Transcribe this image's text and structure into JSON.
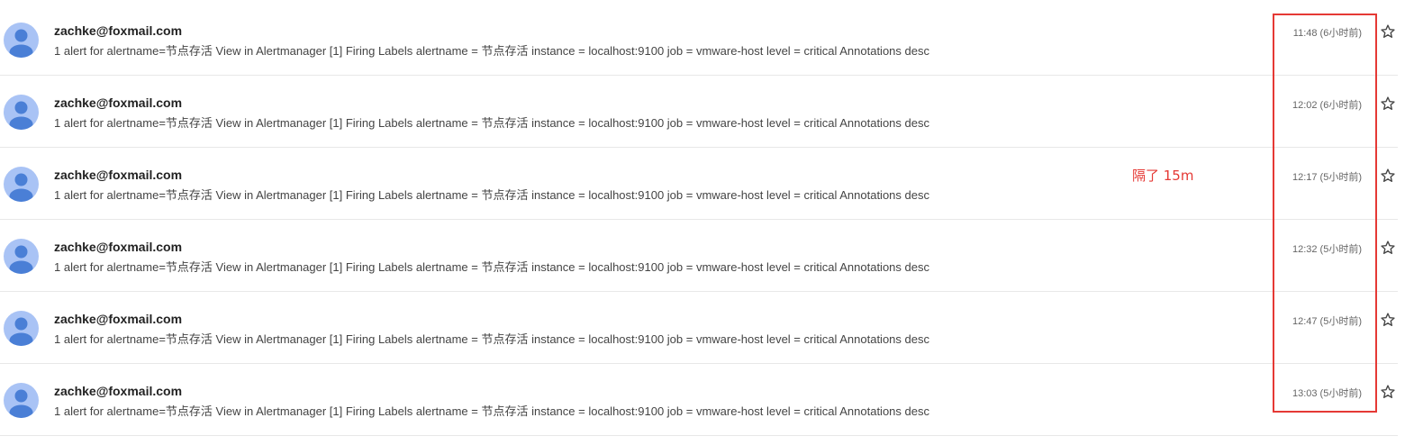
{
  "emails": [
    {
      "sender": "zachke@foxmail.com",
      "preview": "1 alert for alertname=节点存活 View in Alertmanager [1] Firing Labels alertname = 节点存活 instance = localhost:9100 job = vmware-host level = critical Annotations desc",
      "time": "11:48 (6小时前)"
    },
    {
      "sender": "zachke@foxmail.com",
      "preview": "1 alert for alertname=节点存活 View in Alertmanager [1] Firing Labels alertname = 节点存活 instance = localhost:9100 job = vmware-host level = critical Annotations desc",
      "time": "12:02 (6小时前)"
    },
    {
      "sender": "zachke@foxmail.com",
      "preview": "1 alert for alertname=节点存活 View in Alertmanager [1] Firing Labels alertname = 节点存活 instance = localhost:9100 job = vmware-host level = critical Annotations desc",
      "time": "12:17 (5小时前)"
    },
    {
      "sender": "zachke@foxmail.com",
      "preview": "1 alert for alertname=节点存活 View in Alertmanager [1] Firing Labels alertname = 节点存活 instance = localhost:9100 job = vmware-host level = critical Annotations desc",
      "time": "12:32 (5小时前)"
    },
    {
      "sender": "zachke@foxmail.com",
      "preview": "1 alert for alertname=节点存活 View in Alertmanager [1] Firing Labels alertname = 节点存活 instance = localhost:9100 job = vmware-host level = critical Annotations desc",
      "time": "12:47 (5小时前)"
    },
    {
      "sender": "zachke@foxmail.com",
      "preview": "1 alert for alertname=节点存活 View in Alertmanager [1] Firing Labels alertname = 节点存活 instance = localhost:9100 job = vmware-host level = critical Annotations desc",
      "time": "13:03 (5小时前)"
    }
  ],
  "annotation": {
    "text": "隔了 15m",
    "color": "#e53935"
  },
  "icons": {
    "avatar": "default-avatar-icon",
    "star": "star-outline-icon"
  },
  "colors": {
    "avatar_bg": "#a9c3f5",
    "avatar_fg": "#4a7fd6",
    "highlight": "#e53935"
  }
}
